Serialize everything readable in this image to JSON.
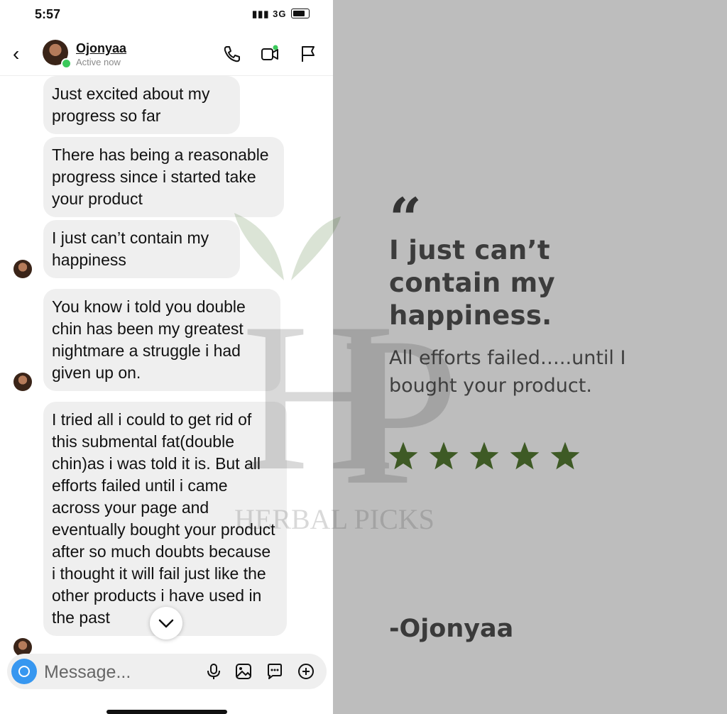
{
  "status_bar": {
    "time": "5:57",
    "network": "3G"
  },
  "header": {
    "contact_name": "Ojonyaa",
    "contact_status": "Active now"
  },
  "messages": [
    "Just excited about my progress so far",
    "There has being a reasonable progress since i started take your product",
    "I just can’t contain my happiness",
    "You know i told you double chin has been my greatest nightmare a struggle i had given up on.",
    "I tried all i could to get rid of this submental fat(double chin)as i was told it is. But all efforts failed until i came across your page and eventually bought your product after so much doubts because i thought it will fail just like the other products i have used in the past"
  ],
  "composer": {
    "placeholder": "Message..."
  },
  "testimonial": {
    "headline": "I just can’t contain my happiness.",
    "subtext": "All efforts failed…..until I bought your product.",
    "rating": 5,
    "max_rating": 5,
    "star_color": "#3e5a25",
    "author": "-Ojonyaa"
  },
  "watermark": {
    "brand": "HERBAL PICKS",
    "monogram": "HP"
  },
  "colors": {
    "accent_blue": "#3797f0",
    "online_green": "#3bc95b",
    "panel_bg": "#bdbdbd",
    "bubble_bg": "#efefef"
  }
}
